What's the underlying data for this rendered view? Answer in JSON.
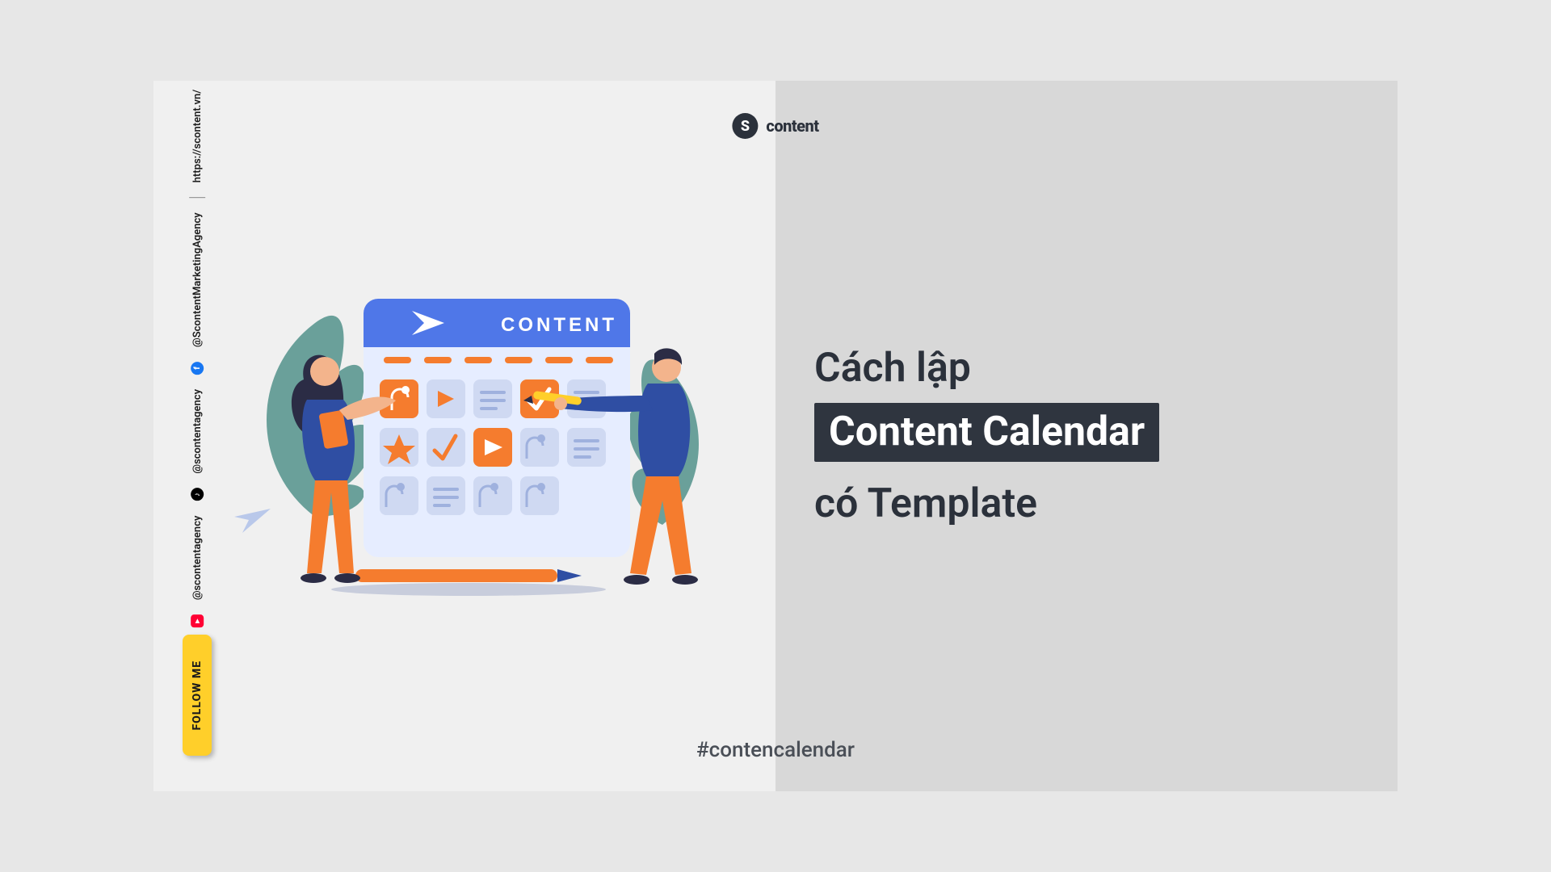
{
  "brand": {
    "badge_letter": "S",
    "name": "content"
  },
  "hashtag": "#contencalendar",
  "headline": {
    "line1": "Cách lập",
    "highlight": "Content Calendar",
    "line3": "có Template"
  },
  "follow": {
    "label": "FOLLOW ME"
  },
  "socials": {
    "youtube": "@scontentagency",
    "tiktok": "@scontentagency",
    "facebook": "@ScontentMarketingAgency",
    "website": "https://scontent.vn/"
  },
  "illustration": {
    "calendar_label": "CONTENT"
  }
}
